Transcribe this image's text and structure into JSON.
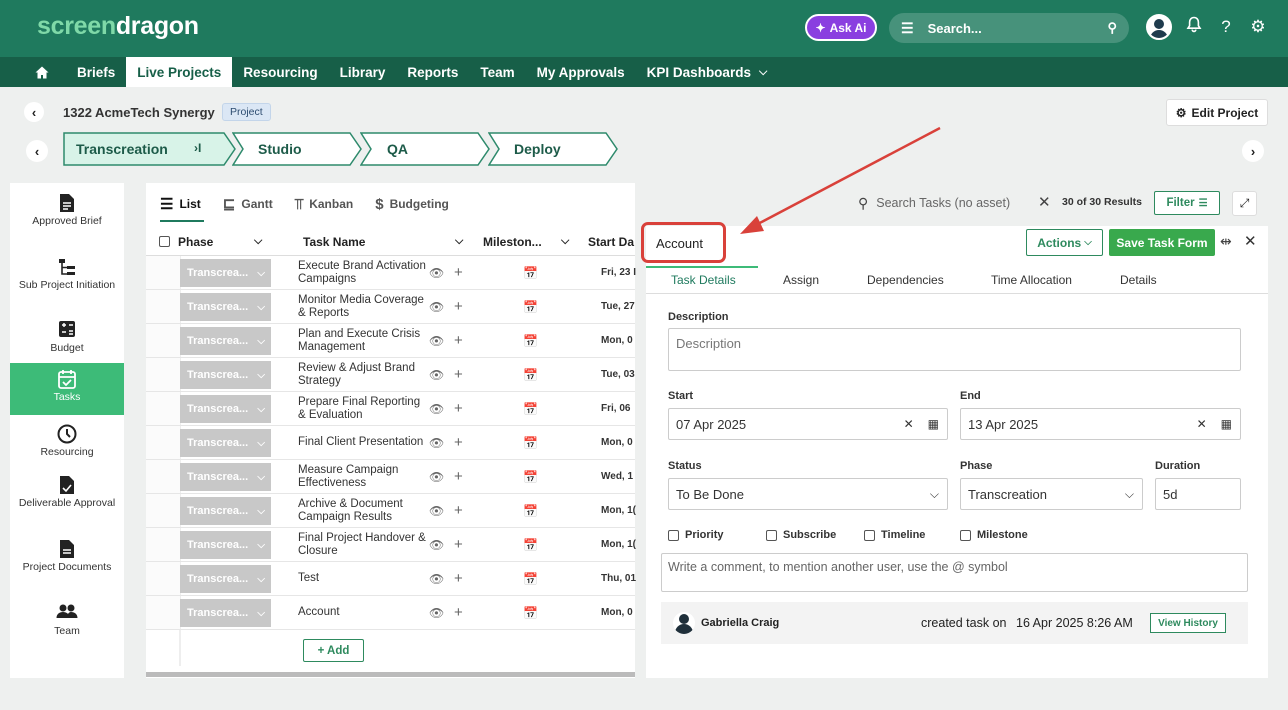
{
  "brand": {
    "logo_part1": "screen",
    "logo_part2": "dragon"
  },
  "topbar": {
    "ask_ai": "Ask Ai",
    "search_placeholder": "Search...",
    "help": "?"
  },
  "nav": {
    "items": [
      "Briefs",
      "Live Projects",
      "Resourcing",
      "Library",
      "Reports",
      "Team",
      "My Approvals",
      "KPI Dashboards"
    ],
    "active": "Live Projects"
  },
  "project": {
    "title": "1322 AcmeTech Synergy",
    "badge": "Project",
    "edit_label": "Edit Project"
  },
  "stages": {
    "items": [
      "Transcreation",
      "Studio",
      "QA",
      "Deploy"
    ],
    "active": "Transcreation",
    "active_marker": "›I"
  },
  "sidebar": {
    "items": [
      {
        "label": "Approved Brief",
        "icon": "document-icon"
      },
      {
        "label": "Sub Project Initiation",
        "icon": "hierarchy-icon"
      },
      {
        "label": "Budget",
        "icon": "calculator-icon"
      },
      {
        "label": "Tasks",
        "icon": "calendar-check-icon"
      },
      {
        "label": "Resourcing",
        "icon": "clock-icon"
      },
      {
        "label": "Deliverable Approval",
        "icon": "document-check-icon"
      },
      {
        "label": "Project Documents",
        "icon": "file-icon"
      },
      {
        "label": "Team",
        "icon": "people-icon"
      }
    ],
    "active": "Tasks"
  },
  "views": {
    "list": "List",
    "gantt": "Gantt",
    "kanban": "Kanban",
    "budgeting": "Budgeting"
  },
  "grid": {
    "headers": {
      "phase": "Phase",
      "task_name": "Task Name",
      "milestone": "Mileston...",
      "start_date": "Start Da"
    },
    "rows": [
      {
        "phase": "Transcrea...",
        "task": "Execute Brand Activation Campaigns",
        "start": "Fri, 23 I"
      },
      {
        "phase": "Transcrea...",
        "task": "Monitor Media Coverage & Reports",
        "start": "Tue, 27"
      },
      {
        "phase": "Transcrea...",
        "task": "Plan and Execute Crisis Management",
        "start": "Mon, 0"
      },
      {
        "phase": "Transcrea...",
        "task": "Review & Adjust Brand Strategy",
        "start": "Tue, 03"
      },
      {
        "phase": "Transcrea...",
        "task": "Prepare Final Reporting & Evaluation",
        "start": "Fri, 06"
      },
      {
        "phase": "Transcrea...",
        "task": "Final Client Presentation",
        "start": "Mon, 0"
      },
      {
        "phase": "Transcrea...",
        "task": "Measure Campaign Effectiveness",
        "start": "Wed, 1"
      },
      {
        "phase": "Transcrea...",
        "task": "Archive & Document Campaign Results",
        "start": "Mon, 1("
      },
      {
        "phase": "Transcrea...",
        "task": "Final Project Handover & Closure",
        "start": "Mon, 1("
      },
      {
        "phase": "Transcrea...",
        "task": "Test",
        "start": "Thu, 01"
      },
      {
        "phase": "Transcrea...",
        "task": "Account",
        "start": "Mon, 0"
      }
    ],
    "add_label": "+ Add"
  },
  "task_toolbar": {
    "search_placeholder": "Search Tasks (no asset)",
    "results": "30 of 30 Results",
    "filter_label": "Filter"
  },
  "task_detail": {
    "name": "Account",
    "actions_label": "Actions",
    "save_label": "Save Task Form",
    "tabs": [
      "Task Details",
      "Assign",
      "Dependencies",
      "Time Allocation",
      "Details"
    ],
    "active_tab": "Task Details",
    "description_label": "Description",
    "description_placeholder": "Description",
    "start_label": "Start",
    "start_value": "07 Apr 2025",
    "end_label": "End",
    "end_value": "13 Apr 2025",
    "status_label": "Status",
    "status_value": "To Be Done",
    "phase_label": "Phase",
    "phase_value": "Transcreation",
    "duration_label": "Duration",
    "duration_value": "5d",
    "checkboxes": [
      "Priority",
      "Subscribe",
      "Timeline",
      "Milestone"
    ],
    "comment_placeholder": "Write a comment, to mention another user, use the @ symbol",
    "history": {
      "user": "Gabriella Craig",
      "action": "created task on",
      "date": "16 Apr 2025 8:26 AM",
      "button": "View History"
    }
  },
  "colors": {
    "brand_green": "#1f7a5e",
    "accent_green": "#3dbb78",
    "annotation_red": "#d9413a"
  }
}
